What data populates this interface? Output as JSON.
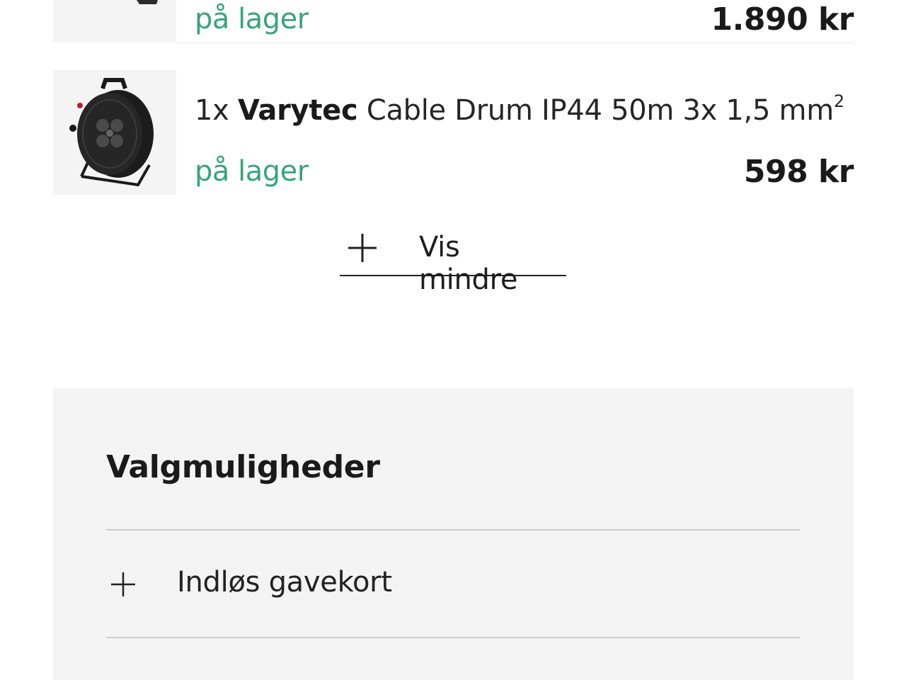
{
  "cart": {
    "items": [
      {
        "quantity": "",
        "brand": "",
        "name": "",
        "stock_status": "på lager",
        "price": "1.890 kr",
        "image_icon": "product-thumbnail-icon"
      },
      {
        "quantity": "1x",
        "brand": "Varytec",
        "name": "Cable Drum IP44 50m 3x 1,5 mm",
        "name_superscript": "2",
        "stock_status": "på lager",
        "price": "598 kr",
        "image_icon": "cable-drum-icon"
      }
    ],
    "toggle_label": "Vis mindre",
    "toggle_icon": "plus-icon"
  },
  "options": {
    "title": "Valgmuligheder",
    "rows": [
      {
        "label": "Indløs gavekort",
        "icon": "plus-icon"
      }
    ]
  },
  "colors": {
    "stock_green": "#39a47a",
    "panel_bg": "#f3f3f3",
    "text_dark": "#1a1a1a"
  }
}
